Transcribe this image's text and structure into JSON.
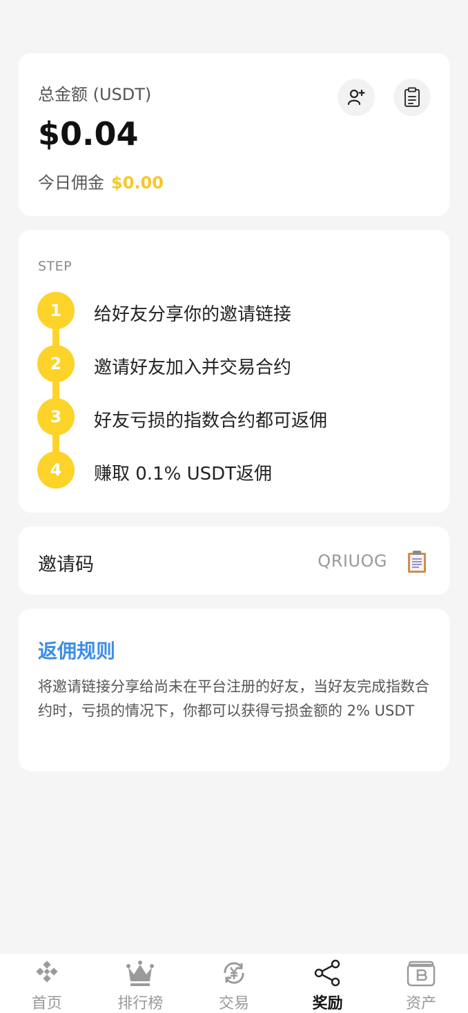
{
  "summary": {
    "total_label": "总金额 (USDT)",
    "total_amount": "$0.04",
    "today_label": "今日佣金",
    "today_value": "$0.00",
    "icons": [
      "add-friend-icon",
      "clipboard-icon"
    ]
  },
  "steps": {
    "title": "STEP",
    "items": [
      {
        "num": "1",
        "text": "给好友分享你的邀请链接"
      },
      {
        "num": "2",
        "text": "邀请好友加入并交易合约"
      },
      {
        "num": "3",
        "text": "好友亏损的指数合约都可返佣"
      },
      {
        "num": "4",
        "text": "赚取 0.1% USDT返佣"
      }
    ],
    "accent_color": "#fdd32a"
  },
  "invite": {
    "label": "邀请码",
    "code": "QRIUOG",
    "copy_icon": "copy-clipboard-icon"
  },
  "rules": {
    "title": "返佣规则",
    "body": "将邀请链接分享给尚未在平台注册的好友，当好友完成指数合约时，亏损的情况下，你都可以获得亏损金额的 2% USDT",
    "title_color": "#3d8de8"
  },
  "tabbar": {
    "tabs": [
      {
        "label": "首页",
        "icon": "home-diamond-icon"
      },
      {
        "label": "排行榜",
        "icon": "crown-icon"
      },
      {
        "label": "交易",
        "icon": "exchange-yen-icon"
      },
      {
        "label": "奖励",
        "icon": "share-icon",
        "active": true
      },
      {
        "label": "资产",
        "icon": "wallet-bitcoin-icon"
      }
    ]
  }
}
